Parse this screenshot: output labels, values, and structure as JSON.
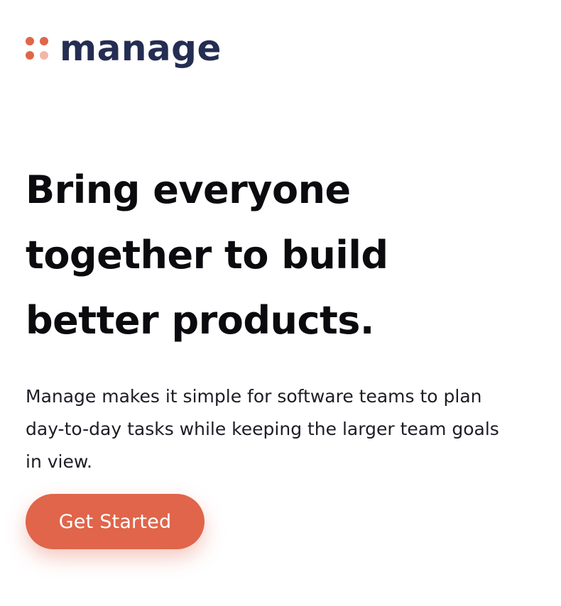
{
  "brand": {
    "name": "manage",
    "icon": "four-dots-logo-icon",
    "colors": {
      "dot_primary": "#e0654a",
      "dot_soft": "#f2b6a5",
      "wordmark": "#242d52"
    }
  },
  "hero": {
    "title": "Bring everyone together to build better products.",
    "description": "Manage makes it simple for software teams to plan day-to-day tasks while keeping the larger team goals in view.",
    "cta_label": "Get Started"
  },
  "colors": {
    "accent": "#e0654a",
    "text": "#0b0b0f"
  }
}
